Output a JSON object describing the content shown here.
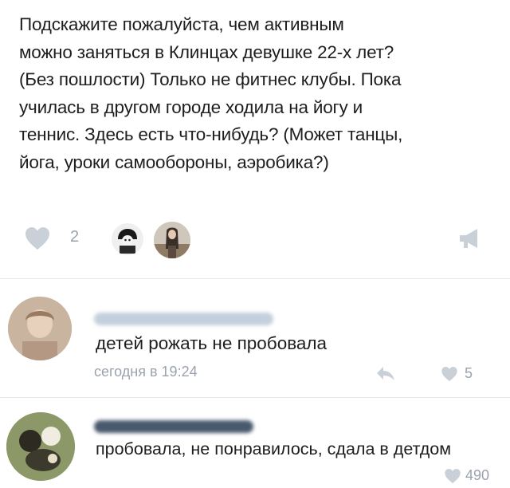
{
  "post": {
    "text_lines": [
      "Подскажите пожалуйста, чем активным",
      "можно заняться в Клинцах девушке 22-х лет?",
      "(Без пошлости) Только не фитнес клубы. Пока",
      "училась в другом городе ходила на йогу и",
      "теннис. Здесь есть что-нибудь? (Может танцы,",
      "йога, уроки самообороны, аэробика?)"
    ],
    "like_count": "2",
    "icons": {
      "like": "heart-icon",
      "share": "megaphone-icon"
    }
  },
  "comments": [
    {
      "text": "детей рожать не пробовала",
      "time": "сегодня в 19:24",
      "likes": "5",
      "icons": {
        "reply": "reply-arrow-icon",
        "like": "heart-icon"
      }
    },
    {
      "text": "пробовала, не понравилось, сдала в детдом",
      "likes": "490",
      "icons": {
        "like": "heart-icon"
      }
    }
  ],
  "colors": {
    "text": "#1e1e1e",
    "muted": "#9aa3ad",
    "heart": "#c9d0d8"
  }
}
